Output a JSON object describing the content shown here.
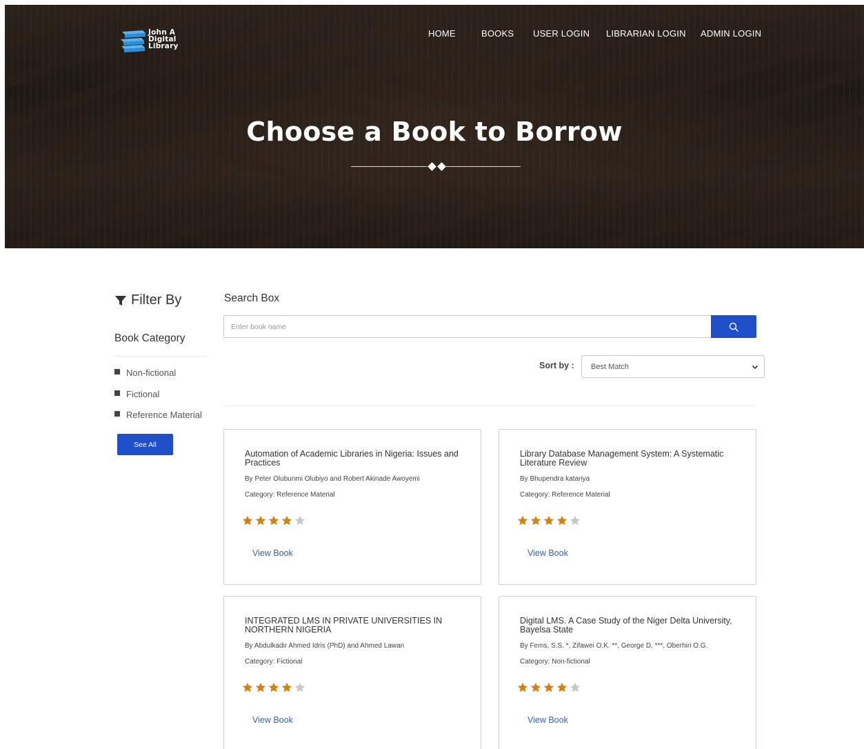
{
  "brand": {
    "logo_line1": "John A",
    "logo_line2": "Digital",
    "logo_line3": "Library"
  },
  "nav": {
    "home": "HOME",
    "books": "BOOKS",
    "user_login": "USER LOGIN",
    "librarian_login": "LIBRARIAN LOGIN",
    "admin_login": "ADMIN LOGIN"
  },
  "hero": {
    "title": "Choose a Book to Borrow"
  },
  "sidebar": {
    "filter_title": "Filter By",
    "category_title": "Book Category",
    "categories": [
      "Non-fictional",
      "Fictional",
      "Reference Material"
    ],
    "see_all": "See All"
  },
  "search": {
    "label": "Search Box",
    "placeholder": "Enter book name"
  },
  "sort": {
    "label": "Sort by :",
    "selected": "Best Match"
  },
  "books": [
    {
      "title": "Automation of Academic Libraries in Nigeria: Issues and Practices",
      "author": "By Peter Olubunmi Olubiyo and Robert Akinade Awoyemi",
      "category": "Category: Reference Material",
      "rating": 4,
      "action": "View Book"
    },
    {
      "title": "Library Database Management System: A Systematic Literature Review",
      "author": "By Bhupendra katariya",
      "category": "Category: Reference Material",
      "rating": 4,
      "action": "View Book"
    },
    {
      "title": "INTEGRATED LMS IN PRIVATE UNIVERSITIES IN NORTHERN NIGERIA",
      "author": "By Abdulkadir Ahmed Idris (PhD) and Ahmed Lawan",
      "category": "Category: Fictional",
      "rating": 4,
      "action": "View Book"
    },
    {
      "title": "Digital LMS. A Case Study of the Niger Delta University, Bayelsa State",
      "author": "By Fems, S.S. *, Zifawei O.K. **, George D. ***, Oberhiri O.G.",
      "category": "Category: Non-fictional",
      "rating": 4,
      "action": "View Book"
    }
  ],
  "colors": {
    "primary": "#1f4fc9",
    "star_filled": "#d4820b",
    "star_empty": "#c8c8c8",
    "link": "#2f64c5"
  }
}
